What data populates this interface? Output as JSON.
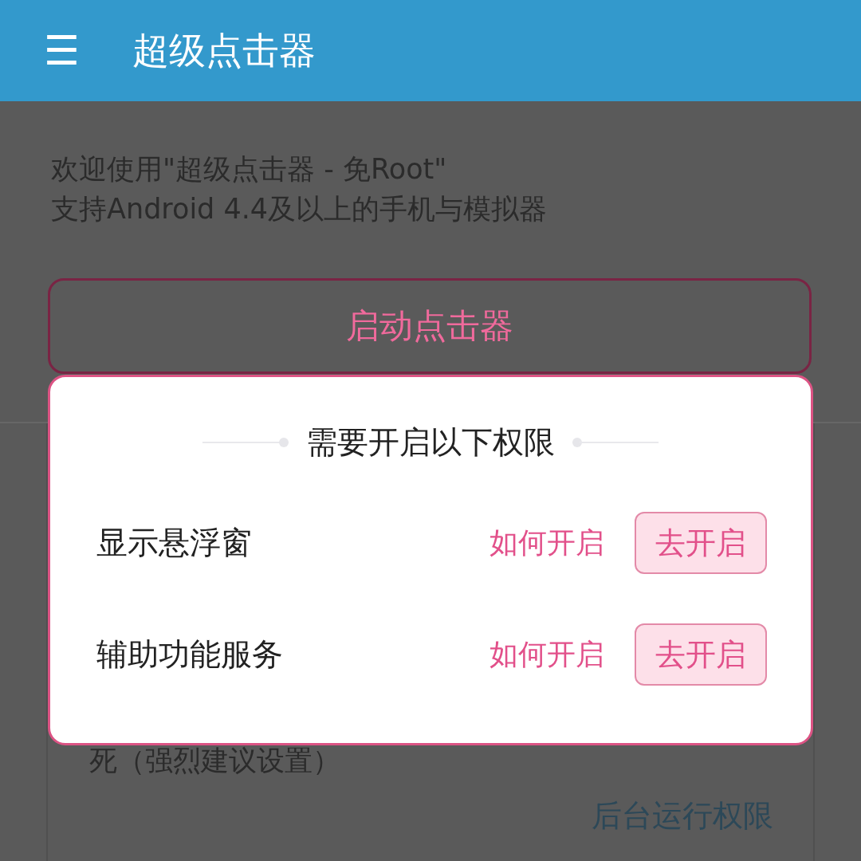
{
  "app_bar": {
    "menu_icon": "☰",
    "title": "超级点击器"
  },
  "intro": [
    "欢迎使用\"超级点击器 - 免Root\"",
    "支持Android 4.4及以上的手机与模拟器"
  ],
  "start_button": "启动点击器",
  "card": {
    "text": "死（强烈建议设置）",
    "link": "后台运行权限"
  },
  "dialog": {
    "title": "需要开启以下权限",
    "rows": [
      {
        "label": "显示悬浮窗",
        "help": "如何开启",
        "button": "去开启"
      },
      {
        "label": "辅助功能服务",
        "help": "如何开启",
        "button": "去开启"
      }
    ]
  }
}
